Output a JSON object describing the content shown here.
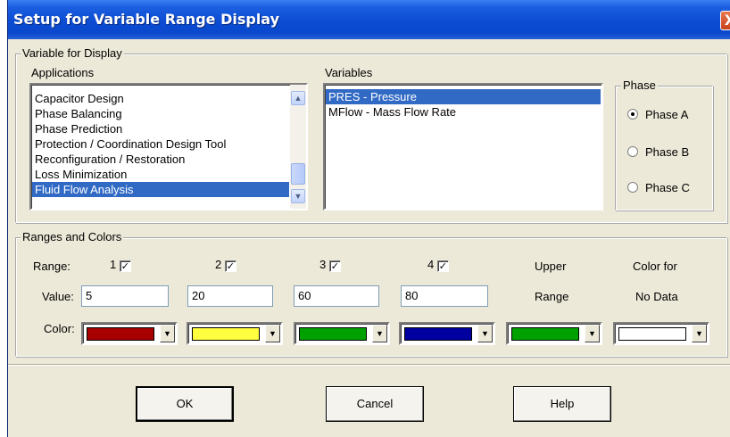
{
  "window": {
    "title": "Setup for Variable Range Display",
    "close_glyph": "X"
  },
  "variable_group": {
    "legend": "Variable for Display",
    "applications_label": "Applications",
    "applications": [
      {
        "label": "Capacitor Design",
        "selected": false
      },
      {
        "label": "Phase Balancing",
        "selected": false
      },
      {
        "label": "Phase Prediction",
        "selected": false
      },
      {
        "label": "Protection / Coordination Design Tool",
        "selected": false
      },
      {
        "label": "Reconfiguration / Restoration",
        "selected": false
      },
      {
        "label": "Loss Minimization",
        "selected": false
      },
      {
        "label": "Fluid Flow Analysis",
        "selected": true
      }
    ],
    "variables_label": "Variables",
    "variables": [
      {
        "label": "PRES - Pressure",
        "selected": true
      },
      {
        "label": "MFlow - Mass Flow Rate",
        "selected": false
      }
    ],
    "phase": {
      "legend": "Phase",
      "options": [
        {
          "label": "Phase A",
          "checked": true
        },
        {
          "label": "Phase B",
          "checked": false
        },
        {
          "label": "Phase C",
          "checked": false
        }
      ]
    }
  },
  "ranges_group": {
    "legend": "Ranges and Colors",
    "range_label": "Range:",
    "value_label": "Value:",
    "color_label": "Color:",
    "ranges": [
      {
        "number": "1",
        "checked": true,
        "value": "5",
        "color": "#a80000"
      },
      {
        "number": "2",
        "checked": true,
        "value": "20",
        "color": "#ffff40"
      },
      {
        "number": "3",
        "checked": true,
        "value": "60",
        "color": "#00a000"
      },
      {
        "number": "4",
        "checked": true,
        "value": "80",
        "color": "#0000a0"
      }
    ],
    "upper_range": {
      "line1": "Upper",
      "line2": "Range",
      "color": "#00a000"
    },
    "no_data": {
      "line1": "Color for",
      "line2": "No Data",
      "color": "#ffffff"
    },
    "check_glyph": "✓",
    "drop_glyph": "▼"
  },
  "buttons": {
    "ok": "OK",
    "cancel": "Cancel",
    "help": "Help"
  },
  "scroll_glyphs": {
    "up": "▲",
    "down": "▼"
  }
}
